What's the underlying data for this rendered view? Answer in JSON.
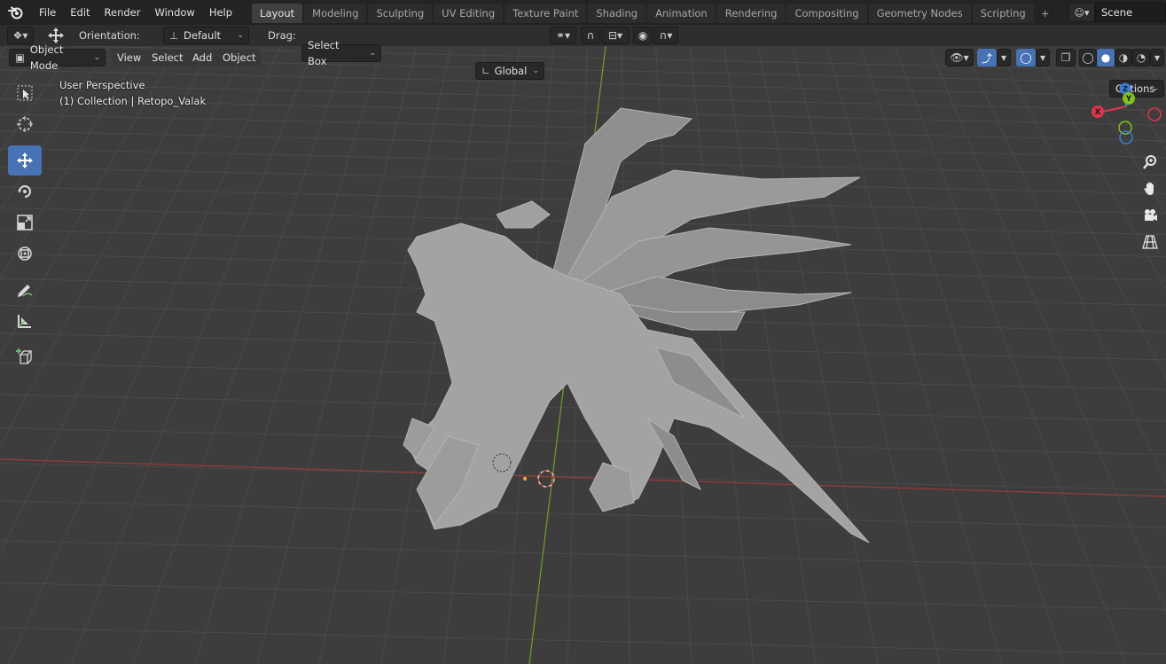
{
  "menubar": {
    "items": [
      "File",
      "Edit",
      "Render",
      "Window",
      "Help"
    ],
    "workspaces": [
      "Layout",
      "Modeling",
      "Sculpting",
      "UV Editing",
      "Texture Paint",
      "Shading",
      "Animation",
      "Rendering",
      "Compositing",
      "Geometry Nodes",
      "Scripting"
    ],
    "active_workspace": "Layout",
    "add_tab": "+",
    "scene_name": "Scene"
  },
  "tool_header": {
    "orientation_label": "Orientation:",
    "orientation_value": "Default",
    "drag_label": "Drag:",
    "drag_value": "Select Box",
    "transform_orientation": "Global",
    "options_label": "Options"
  },
  "viewport_header": {
    "mode": "Object Mode",
    "menus": [
      "View",
      "Select",
      "Add",
      "Object"
    ]
  },
  "overlay": {
    "line1": "User Perspective",
    "line2": "(1) Collection | Retopo_Valak"
  },
  "gizmo": {
    "x_label": "X",
    "y_label": "Y",
    "z_label": "Z",
    "x_color": "#e0354a",
    "y_color": "#7fc21a",
    "z_color": "#3b7ad6"
  },
  "tools": [
    "select-box-icon",
    "cursor-icon",
    "move-icon",
    "rotate-icon",
    "scale-icon",
    "transform-icon",
    "annotate-icon",
    "measure-icon",
    "add-cube-icon"
  ],
  "colors": {
    "accent": "#4772b3",
    "x_axis_line": "#9b3a3a",
    "y_axis_line": "#6fa02a",
    "viewport_bg": "#3d3d3d"
  }
}
